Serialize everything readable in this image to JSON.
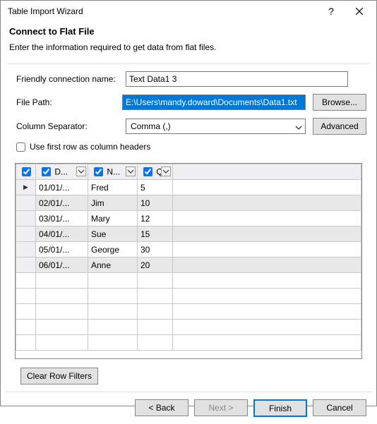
{
  "window": {
    "title": "Table Import Wizard"
  },
  "header": {
    "title": "Connect to Flat File",
    "subtitle": "Enter the information required to get data from flat files."
  },
  "form": {
    "connection_label": "Friendly connection name:",
    "connection_value": "Text Data1 3",
    "filepath_label": "File Path:",
    "filepath_value": "E:\\Users\\mandy.doward\\Documents\\Data1.txt",
    "browse_label": "Browse...",
    "separator_label": "Column Separator:",
    "separator_value": "Comma (,)",
    "advanced_label": "Advanced",
    "firstrow_label": "Use first row as column headers"
  },
  "grid": {
    "columns": [
      "D...",
      "N...",
      "Q."
    ],
    "rows": [
      {
        "d": "01/01/...",
        "n": "Fred",
        "q": "5"
      },
      {
        "d": "02/01/...",
        "n": "Jim",
        "q": "10"
      },
      {
        "d": "03/01/...",
        "n": "Mary",
        "q": "12"
      },
      {
        "d": "04/01/...",
        "n": "Sue",
        "q": "15"
      },
      {
        "d": "05/01/...",
        "n": "George",
        "q": "30"
      },
      {
        "d": "06/01/...",
        "n": "Anne",
        "q": "20"
      }
    ]
  },
  "buttons": {
    "clear_filters": "Clear Row Filters",
    "back": "< Back",
    "next": "Next >",
    "finish": "Finish",
    "cancel": "Cancel"
  }
}
